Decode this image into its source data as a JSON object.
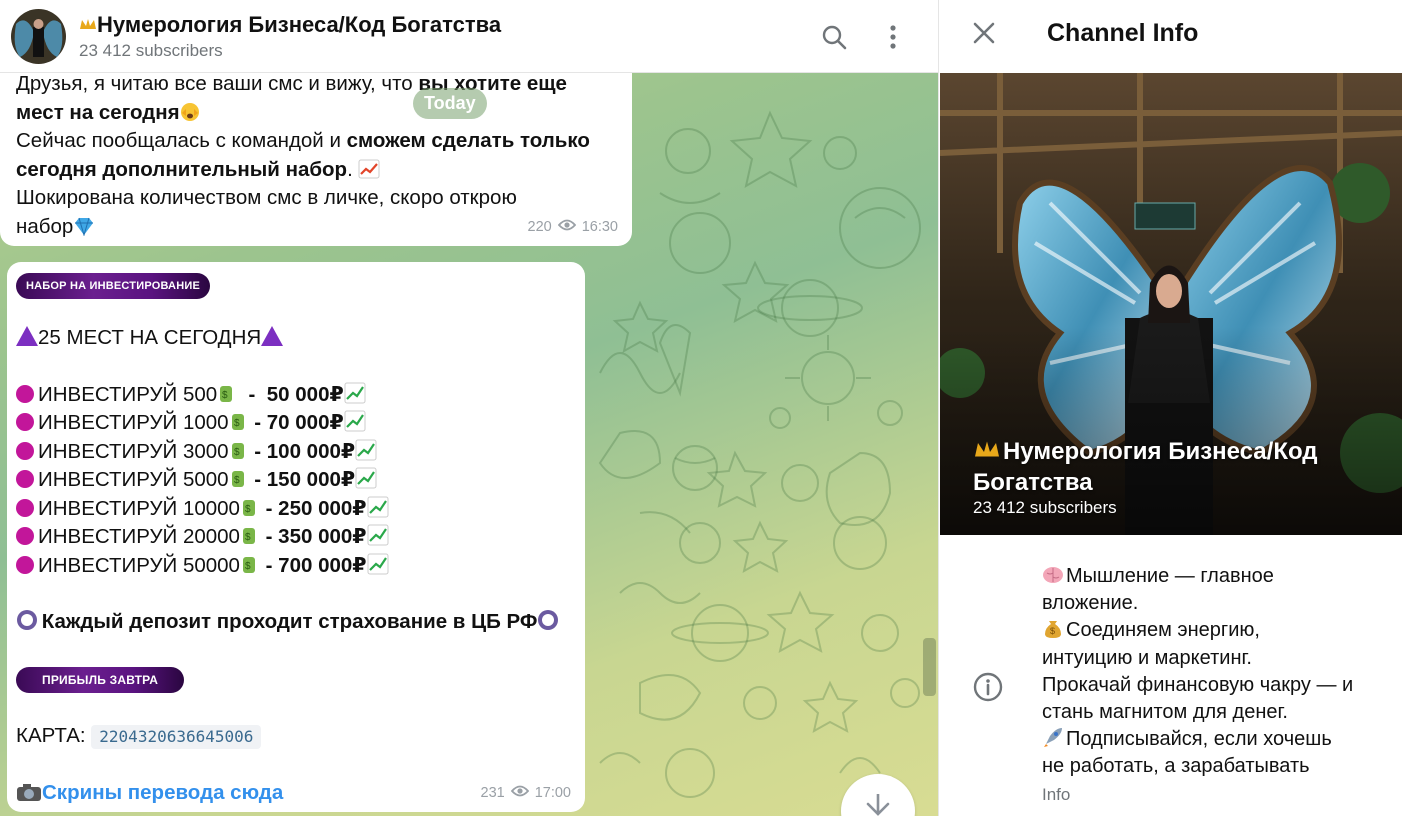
{
  "header": {
    "title": "Нумерология Бизнеса/Код Богатства",
    "subscribers": "23 412 subscribers"
  },
  "date_chip": "Today",
  "message1": {
    "lines": [
      "Друзья, я читаю все ваши смс и вижу, что ",
      "вы хотите еще",
      "мест на сегодня",
      "Сейчас пообщалась с командой и ",
      "сможем сделать только",
      "сегодня дополнительный набор",
      ". ",
      "Шокирована количеством смс в личке, скоро открою",
      "набор"
    ],
    "views": "220",
    "time": "16:30"
  },
  "message2": {
    "banner1": "НАБОР НА ИНВЕСТИРОВАНИЕ",
    "headline": "25 МЕСТ НА СЕГОДНЯ",
    "items": [
      {
        "label": "ИНВЕСТИРУЙ 500",
        "amount": "  -  50 000₽"
      },
      {
        "label": "ИНВЕСТИРУЙ 1000",
        "amount": " - 70 000₽"
      },
      {
        "label": "ИНВЕСТИРУЙ 3000",
        "amount": " - 100 000₽"
      },
      {
        "label": "ИНВЕСТИРУЙ 5000",
        "amount": " - 150 000₽"
      },
      {
        "label": "ИНВЕСТИРУЙ 10000",
        "amount": " - 250 000₽"
      },
      {
        "label": "ИНВЕСТИРУЙ 20000",
        "amount": " - 350 000₽"
      },
      {
        "label": "ИНВЕСТИРУЙ 50000",
        "amount": " - 700 000₽"
      }
    ],
    "insurance": "Каждый депозит проходит страхование в ЦБ РФ",
    "banner2": "ПРИБЫЛЬ ЗАВТРА",
    "card_label": "КАРТА:",
    "card_number": "2204320636645006",
    "link": "Скрины перевода сюда",
    "views": "231",
    "time": "17:00"
  },
  "info_panel": {
    "title": "Channel Info",
    "name": "Нумерология Бизнеса/Код Богатства",
    "subscribers": "23 412 subscribers",
    "description": [
      "Мышление — главное",
      "вложение.",
      "Соединяем энергию,",
      "интуицию и маркетинг.",
      "Прокачай финансовую чакру — и",
      "стань магнитом для денег.",
      "Подписывайся, если хочешь",
      "не работать, а зарабатывать"
    ],
    "description_label": "Info"
  },
  "colors": {
    "accent_link": "#3390ec",
    "meta_gray": "#707579",
    "bullet_magenta": "#c2169a",
    "banner_purple": "#5a1380"
  },
  "icons": [
    "crown-icon",
    "search-icon",
    "more-vertical-icon",
    "eye-icon",
    "close-icon",
    "info-icon",
    "arrow-down-icon",
    "camera-icon",
    "gem-icon",
    "chart-up-icon",
    "money-bag-icon",
    "brain-icon",
    "rocket-icon",
    "warning-icon",
    "seal-icon"
  ]
}
